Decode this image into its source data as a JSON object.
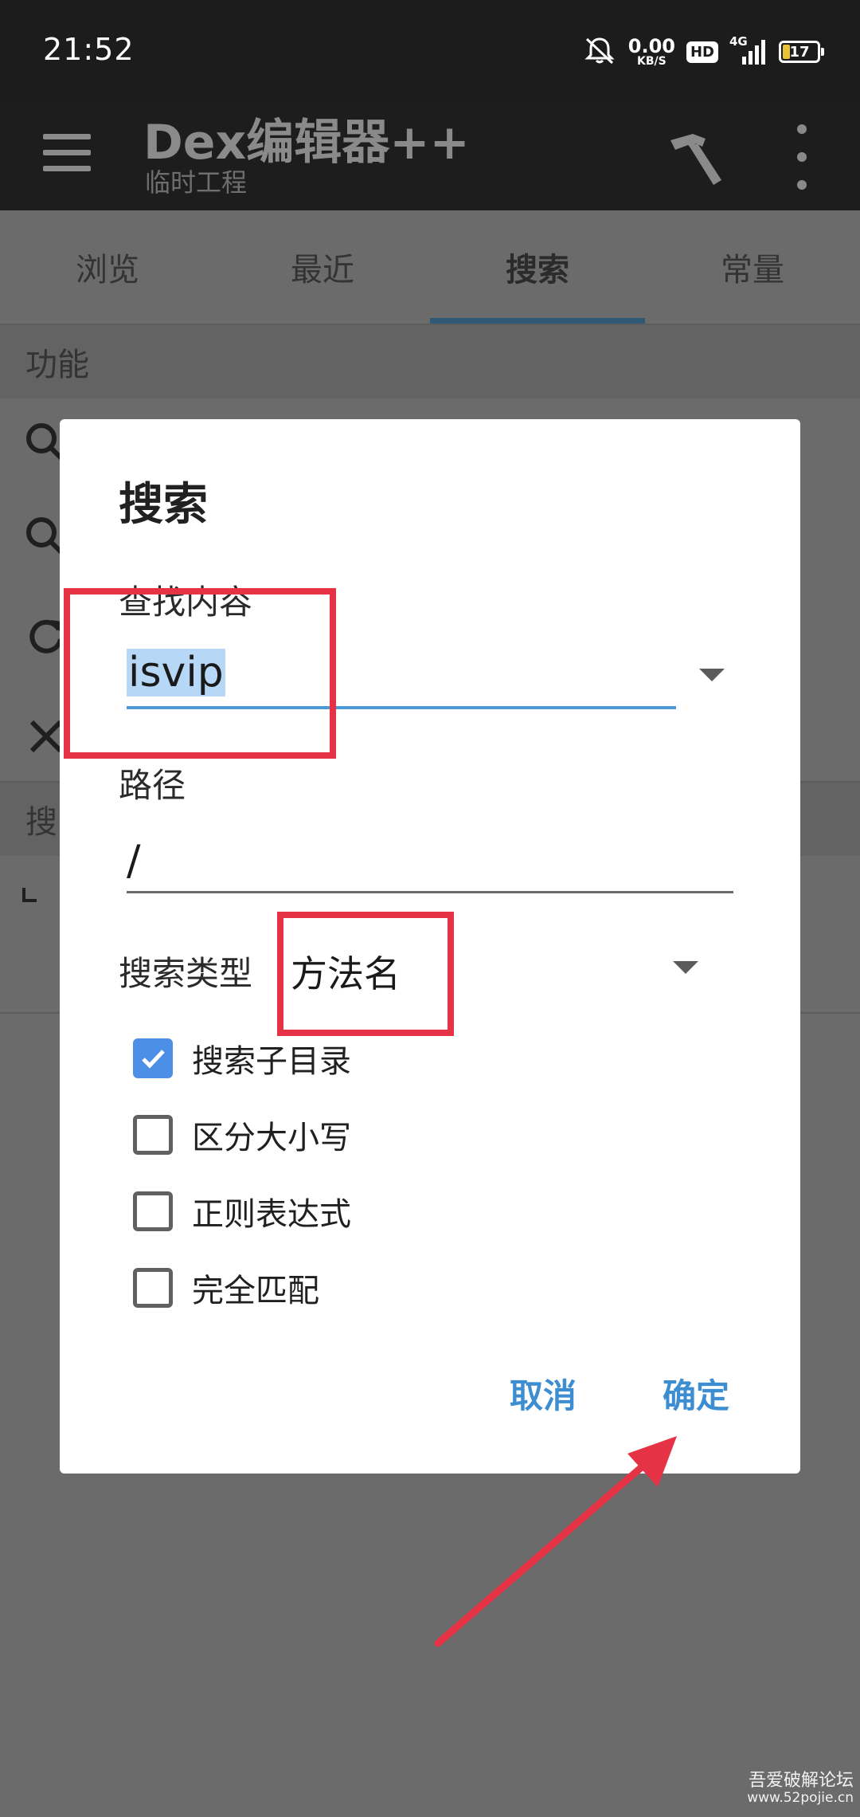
{
  "status_bar": {
    "time": "21:52",
    "speed_value": "0.00",
    "speed_unit": "KB/S",
    "hd": "HD",
    "network": "4G",
    "battery": "17"
  },
  "app_bar": {
    "title": "Dex编辑器++",
    "subtitle": "临时工程",
    "icons": [
      "menu-icon",
      "hammer-icon",
      "overflow-icon"
    ]
  },
  "tabs": [
    {
      "label": "浏览",
      "active": false
    },
    {
      "label": "最近",
      "active": false
    },
    {
      "label": "搜索",
      "active": true
    },
    {
      "label": "常量",
      "active": false
    }
  ],
  "background": {
    "section_header": "功能",
    "second_header_partial": "搜",
    "list_icons": [
      "search-icon",
      "search-icon",
      "refresh-icon",
      "close-icon"
    ]
  },
  "dialog": {
    "title": "搜索",
    "find_label": "查找内容",
    "find_value": "isvip",
    "path_label": "路径",
    "path_value": "/",
    "type_label": "搜索类型",
    "type_value": "方法名",
    "options": [
      {
        "label": "搜索子目录",
        "checked": true
      },
      {
        "label": "区分大小写",
        "checked": false
      },
      {
        "label": "正则表达式",
        "checked": false
      },
      {
        "label": "完全匹配",
        "checked": false
      }
    ],
    "cancel_label": "取消",
    "ok_label": "确定"
  },
  "colors": {
    "accent": "#3c8dd1",
    "annotation": "#e53345",
    "checkbox_checked": "#4b8fe6",
    "selection": "#b7d7f7"
  },
  "watermark": {
    "line1": "吾爱破解论坛",
    "line2": "www.52pojie.cn"
  }
}
